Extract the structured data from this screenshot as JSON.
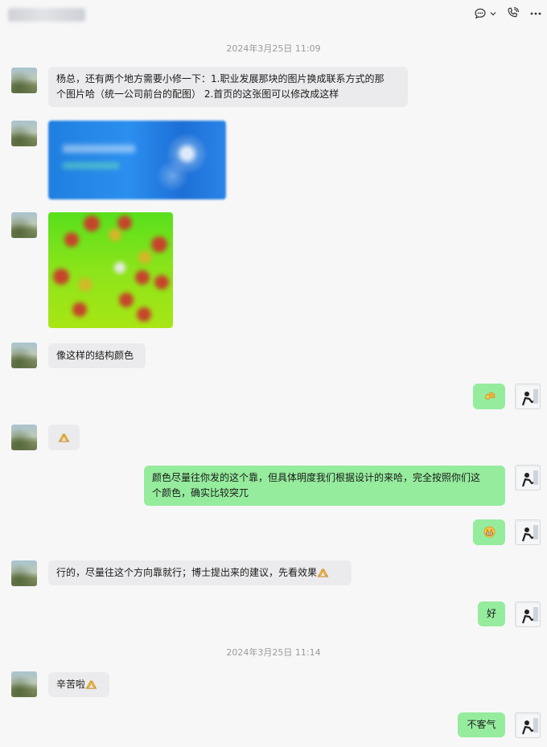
{
  "header": {
    "actions": [
      {
        "icon": "chat-bubble-icon",
        "has_dropdown": true
      },
      {
        "icon": "phone-icon"
      },
      {
        "icon": "more-icon"
      }
    ]
  },
  "timestamps": [
    "2024年3月25日 11:09",
    "2024年3月25日 11:14"
  ],
  "messages": [
    {
      "from": "other",
      "text_line1": "杨总，还有两个地方需要小修一下：1.职业发展那块的图片换成联系方式的那",
      "text_line2": "个图片哈（统一公司前台的配图）  2.首页的这张图可以修改成这样"
    },
    {
      "from": "other",
      "type": "image",
      "image": "blue-contact-image"
    },
    {
      "from": "other",
      "type": "image",
      "image": "green-structure-image"
    },
    {
      "from": "other",
      "text": "像这样的结构颜色"
    },
    {
      "from": "me",
      "emoji": "ok-hand-emoji"
    },
    {
      "from": "other",
      "emoji": "hands-together-emoji"
    },
    {
      "from": "me",
      "text_line1": "颜色尽量往你发的这个靠，但具体明度我们根据设计的来哈，完全按照你们这",
      "text_line2": "个颜色，确实比较突兀"
    },
    {
      "from": "me",
      "emoji": "grin-emoji"
    },
    {
      "from": "other",
      "text": "行的，尽量往这个方向靠就行；博士提出来的建议，先看效果",
      "emoji": "hands-together-emoji"
    },
    {
      "from": "me",
      "text": "好"
    },
    {
      "from": "other",
      "text": "辛苦啦",
      "emoji": "hands-together-emoji"
    },
    {
      "from": "me",
      "text": "不客气"
    }
  ],
  "colors": {
    "incoming_bubble": "#ebebed",
    "outgoing_bubble": "#95ec9d",
    "background": "#f7f7f8"
  }
}
